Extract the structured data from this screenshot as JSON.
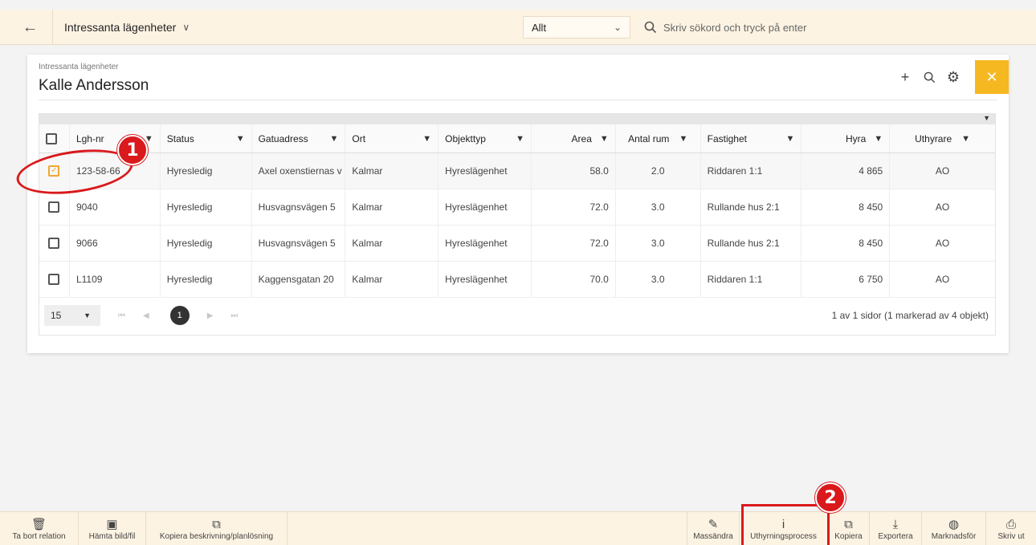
{
  "topbar": {
    "back_icon": "arrow-left-icon",
    "page_title": "Intressanta lägenheter",
    "filter_value": "Allt",
    "search_placeholder": "Skriv sökord och tryck på enter"
  },
  "card": {
    "subtitle": "Intressanta lägenheter",
    "title": "Kalle Andersson"
  },
  "table": {
    "columns": [
      "Lgh-nr",
      "Status",
      "Gatuadress",
      "Ort",
      "Objekttyp",
      "Area",
      "Antal rum",
      "Fastighet",
      "Hyra",
      "Uthyrare"
    ],
    "rows": [
      {
        "checked": true,
        "lgh": "123-58-66",
        "status": "Hyresledig",
        "adress": "Axel oxenstiernas v",
        "ort": "Kalmar",
        "typ": "Hyreslägenhet",
        "area": "58.0",
        "rum": "2.0",
        "fastighet": "Riddaren 1:1",
        "hyra": "4 865",
        "uthyrare": "AO"
      },
      {
        "checked": false,
        "lgh": "9040",
        "status": "Hyresledig",
        "adress": "Husvagnsvägen 5",
        "ort": "Kalmar",
        "typ": "Hyreslägenhet",
        "area": "72.0",
        "rum": "3.0",
        "fastighet": "Rullande hus 2:1",
        "hyra": "8 450",
        "uthyrare": "AO"
      },
      {
        "checked": false,
        "lgh": "9066",
        "status": "Hyresledig",
        "adress": "Husvagnsvägen 5",
        "ort": "Kalmar",
        "typ": "Hyreslägenhet",
        "area": "72.0",
        "rum": "3.0",
        "fastighet": "Rullande hus 2:1",
        "hyra": "8 450",
        "uthyrare": "AO"
      },
      {
        "checked": false,
        "lgh": "L1109",
        "status": "Hyresledig",
        "adress": "Kaggensgatan 20",
        "ort": "Kalmar",
        "typ": "Hyreslägenhet",
        "area": "70.0",
        "rum": "3.0",
        "fastighet": "Riddaren 1:1",
        "hyra": "6 750",
        "uthyrare": "AO"
      }
    ]
  },
  "pager": {
    "page_size": "15",
    "current_page": "1",
    "info": "1 av 1 sidor (1 markerad av 4 objekt)"
  },
  "annotations": {
    "badge1": "1",
    "badge2": "2",
    "color": "#d9191c"
  },
  "bottombar": {
    "delete": "Ta bort relation",
    "fetch": "Hämta bild/fil",
    "copy_desc": "Kopiera beskrivning/planlösning",
    "mass_edit": "Massändra",
    "process": "Uthyrningsprocess",
    "copy": "Kopiera",
    "export": "Exportera",
    "market": "Marknadsför",
    "print": "Skriv ut"
  },
  "colors": {
    "accent": "#f5b821",
    "bar_bg": "#fdf3e3",
    "check": "#f0a730"
  }
}
